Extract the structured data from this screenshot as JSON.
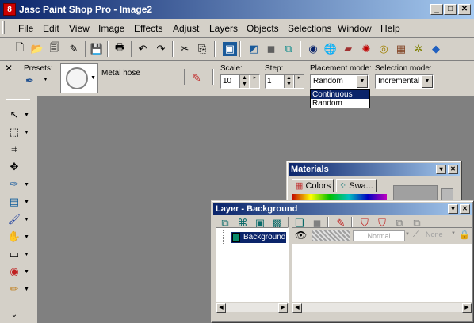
{
  "window": {
    "title": "Jasc Paint Shop Pro - Image2",
    "app_icon": "8"
  },
  "menu": [
    "File",
    "Edit",
    "View",
    "Image",
    "Effects",
    "Adjust",
    "Layers",
    "Objects",
    "Selections",
    "Window",
    "Help"
  ],
  "options": {
    "presets_label": "Presets:",
    "brush_name": "Metal hose",
    "scale_label": "Scale:",
    "scale_value": "10",
    "step_label": "Step:",
    "step_value": "1",
    "placement_label": "Placement mode:",
    "placement_value": "Random",
    "placement_options": [
      "Continuous",
      "Random"
    ],
    "selection_label": "Selection mode:",
    "selection_value": "Incremental"
  },
  "materials": {
    "title": "Materials",
    "tab_colors": "Colors",
    "tab_swatches": "Swa..."
  },
  "layers": {
    "title": "Layer - Background",
    "layer_name": "Background",
    "blend_mode": "Normal",
    "mask": "None"
  },
  "colors": {
    "title_dark": "#0a246a",
    "title_light": "#a6caf0",
    "workspace": "#808080",
    "face": "#d4d0c8"
  }
}
